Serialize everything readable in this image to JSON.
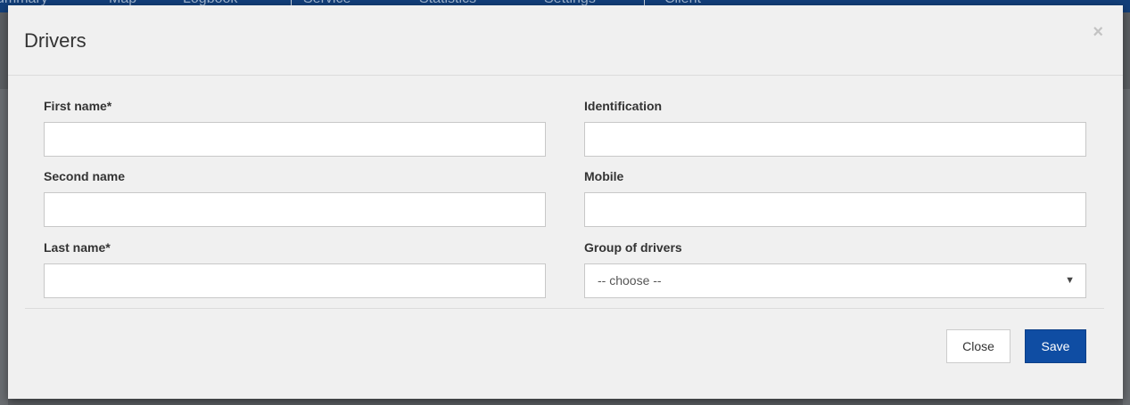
{
  "background_nav": {
    "items": [
      "ummary",
      "Map",
      "Logbook",
      "Service",
      "Statistics",
      "Settings",
      "Client"
    ]
  },
  "modal": {
    "title": "Drivers",
    "close_icon": "×",
    "fields": {
      "first_name": {
        "label": "First name*",
        "value": ""
      },
      "second_name": {
        "label": "Second name",
        "value": ""
      },
      "last_name": {
        "label": "Last name*",
        "value": ""
      },
      "identification": {
        "label": "Identification",
        "value": ""
      },
      "mobile": {
        "label": "Mobile",
        "value": ""
      },
      "group_of_drivers": {
        "label": "Group of drivers",
        "selected": "-- choose --"
      }
    },
    "buttons": {
      "close": "Close",
      "save": "Save"
    }
  },
  "colors": {
    "accent": "#0f4da3",
    "nav_bg": "#123f7a",
    "modal_bg": "#f0f0f0"
  }
}
